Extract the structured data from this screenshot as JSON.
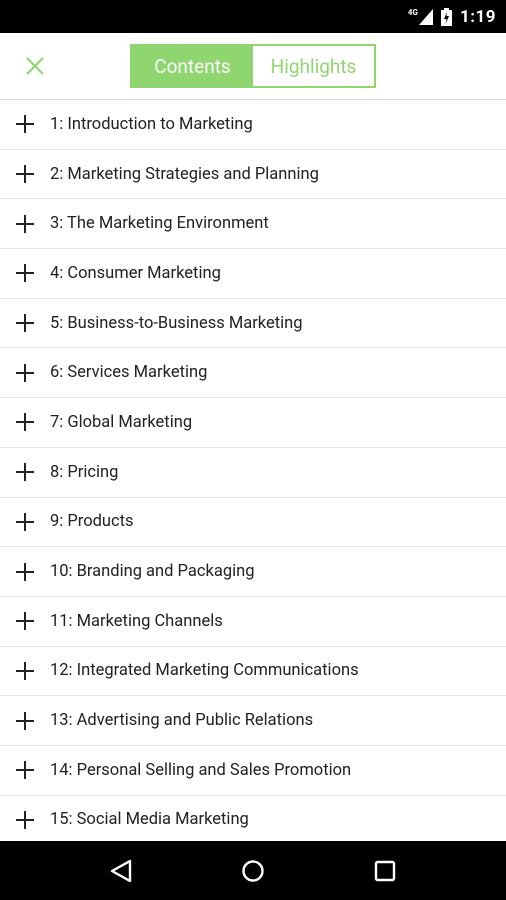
{
  "status_bar": {
    "network_label": "4G",
    "time": "1:19"
  },
  "toolbar": {
    "tabs": [
      {
        "label": "Contents",
        "active": true
      },
      {
        "label": "Highlights",
        "active": false
      }
    ],
    "accent_color": "#8fd670"
  },
  "chapters": [
    "1: Introduction to Marketing",
    "2: Marketing Strategies and Planning",
    "3: The Marketing Environment",
    "4: Consumer Marketing",
    "5: Business-to-Business Marketing",
    "6: Services Marketing",
    "7: Global Marketing",
    "8: Pricing",
    "9: Products",
    "10: Branding and Packaging",
    "11: Marketing Channels",
    "12: Integrated Marketing Communications",
    "13: Advertising and Public Relations",
    "14: Personal Selling and Sales Promotion",
    "15: Social Media Marketing"
  ],
  "icons": {
    "close": "close-icon",
    "expand": "plus-icon",
    "back": "back-icon",
    "home": "home-icon",
    "recents": "recents-icon"
  }
}
